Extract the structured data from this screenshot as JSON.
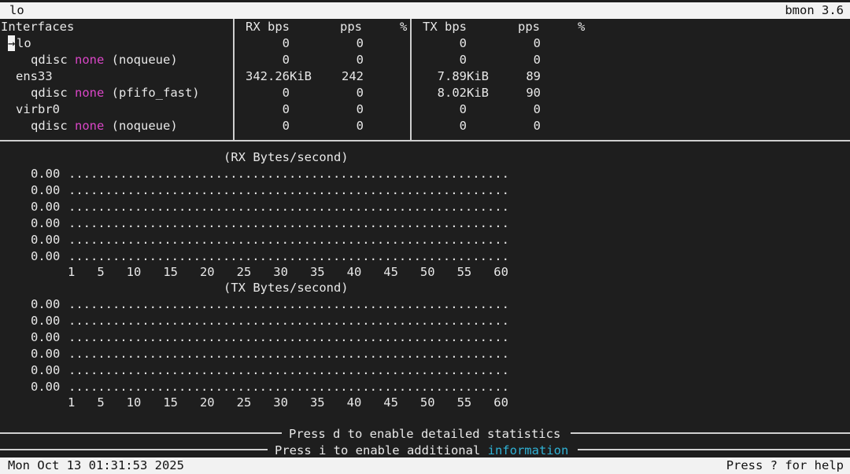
{
  "title_bar": {
    "left": "lo",
    "right": "bmon 3.6"
  },
  "table": {
    "headers": {
      "interfaces": "Interfaces",
      "rx_bps": "RX bps",
      "rx_pps": "pps",
      "rx_pct": "%",
      "tx_bps": "TX bps",
      "tx_pps": "pps",
      "tx_pct": "%"
    },
    "rows": [
      {
        "cursor": "→",
        "name": "lo",
        "rx_bps": "0",
        "rx_pps": "0",
        "tx_bps": "0",
        "tx_pps": "0"
      },
      {
        "name": "qdisc ",
        "qdisc": "none",
        "extra": " (noqueue)",
        "rx_bps": "0",
        "rx_pps": "0",
        "tx_bps": "0",
        "tx_pps": "0"
      },
      {
        "name": "ens33",
        "rx_bps": "342.26KiB",
        "rx_pps": "242",
        "tx_bps": "7.89KiB",
        "tx_pps": "89"
      },
      {
        "name": "qdisc ",
        "qdisc": "none",
        "extra": " (pfifo_fast)",
        "rx_bps": "0",
        "rx_pps": "0",
        "tx_bps": "8.02KiB",
        "tx_pps": "90"
      },
      {
        "name": "virbr0",
        "rx_bps": "0",
        "rx_pps": "0",
        "tx_bps": "0",
        "tx_pps": "0"
      },
      {
        "name": "qdisc ",
        "qdisc": "none",
        "extra": " (noqueue)",
        "rx_bps": "0",
        "rx_pps": "0",
        "tx_bps": "0",
        "tx_pps": "0"
      }
    ]
  },
  "graphs": [
    {
      "title": "(RX Bytes/second)",
      "y_labels": [
        "0.00",
        "0.00",
        "0.00",
        "0.00",
        "0.00",
        "0.00"
      ],
      "dots": "............................................................",
      "x_axis": "1   5   10   15   20   25   30   35   40   45   50   55   60"
    },
    {
      "title": "(TX Bytes/second)",
      "y_labels": [
        "0.00",
        "0.00",
        "0.00",
        "0.00",
        "0.00",
        "0.00"
      ],
      "dots": "............................................................",
      "x_axis": "1   5   10   15   20   25   30   35   40   45   50   55   60"
    }
  ],
  "hints": {
    "detailed": "Press d to enable detailed statistics",
    "info_prefix": "Press i to enable additional ",
    "info_word": "information"
  },
  "status_bar": {
    "left": "Mon Oct 13 01:31:53 2025",
    "right": "Press ? for help"
  }
}
